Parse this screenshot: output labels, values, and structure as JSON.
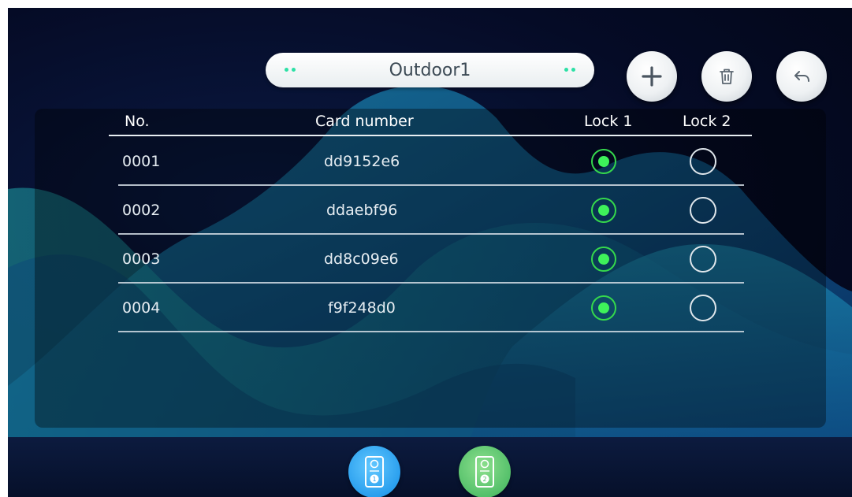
{
  "header": {
    "title": "Outdoor1",
    "add_icon": "plus-icon",
    "delete_icon": "trash-icon",
    "back_icon": "back-arrow-icon"
  },
  "table": {
    "columns": [
      "No.",
      "Card number",
      "Lock 1",
      "Lock 2"
    ],
    "rows": [
      {
        "no": "0001",
        "card": "dd9152e6",
        "lock1": true,
        "lock2": false
      },
      {
        "no": "0002",
        "card": "ddaebf96",
        "lock1": true,
        "lock2": false
      },
      {
        "no": "0003",
        "card": "dd8c09e6",
        "lock1": true,
        "lock2": false
      },
      {
        "no": "0004",
        "card": "f9f248d0",
        "lock1": true,
        "lock2": false
      }
    ]
  },
  "bottom_nav": {
    "items": [
      {
        "icon": "outdoor-station-1-icon",
        "color": "#2a9fee"
      },
      {
        "icon": "outdoor-station-2-icon",
        "color": "#54c06a"
      }
    ]
  },
  "colors": {
    "accent_green": "#3ef25a",
    "background": "#050b26"
  }
}
